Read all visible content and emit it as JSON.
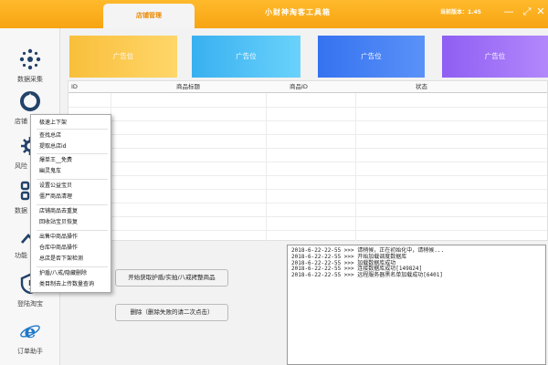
{
  "titlebar": {
    "tab_store": "店铺管理",
    "app_title": "小财神淘客工具箱",
    "version": "当前版本：1.45"
  },
  "sidebar": {
    "items": [
      {
        "label": "数据采集",
        "icon": "data-collect-icon"
      },
      {
        "label": "店铺",
        "icon": "store-icon"
      },
      {
        "label": "风险",
        "icon": "risk-icon"
      },
      {
        "label": "数据",
        "icon": "data-icon"
      },
      {
        "label": "功能",
        "icon": "function-icon"
      },
      {
        "label": "登陆淘宝",
        "icon": "taobao-login-icon"
      },
      {
        "label": "订单助手",
        "icon": "order-helper-icon"
      }
    ]
  },
  "banners": [
    {
      "label": "广告位",
      "color": "#f9bf3b"
    },
    {
      "label": "广告位",
      "color": "#4fc3f7"
    },
    {
      "label": "广告位",
      "color": "#3f7ff5"
    },
    {
      "label": "广告位",
      "color": "#9d6cf7"
    }
  ],
  "table": {
    "headers": [
      "ID",
      "商品标题",
      "商品ID",
      "状态"
    ]
  },
  "buttons": {
    "fetch": "开始获取护盾/实拍/八戒拷整商品",
    "delete": "删除（删除失败的请二次点击）"
  },
  "log": [
    "2018-6-22-22-55 >>> 请稍候，正在初始化中，请稍候...",
    "2018-6-22-22-55 >>> 开始加载调度数据库",
    "2018-6-22-22-55 >>> 加载数据库成功",
    "2018-6-22-22-55 >>> 连接数据库成功[149824]",
    "2018-6-22-22-55 >>> 远程服务器黑名单加载成功[6401]"
  ],
  "context_menu": {
    "items": [
      "极速上下架",
      "查找总店",
      "提取总店id",
      "爆单王__免费",
      "幽灵鬼车",
      "设置公益宝贝",
      "僵尸商品清理",
      "店铺商品去重复",
      "回收站宝贝恢复",
      "出售中商品操作",
      "仓库中商品操作",
      "总店是否下架检测",
      "护盾/八戒/隐藏删除",
      "类目制去上传数量查询"
    ]
  },
  "colors": {
    "titlebar": "#f7a412",
    "accent": "#ee8a00"
  }
}
